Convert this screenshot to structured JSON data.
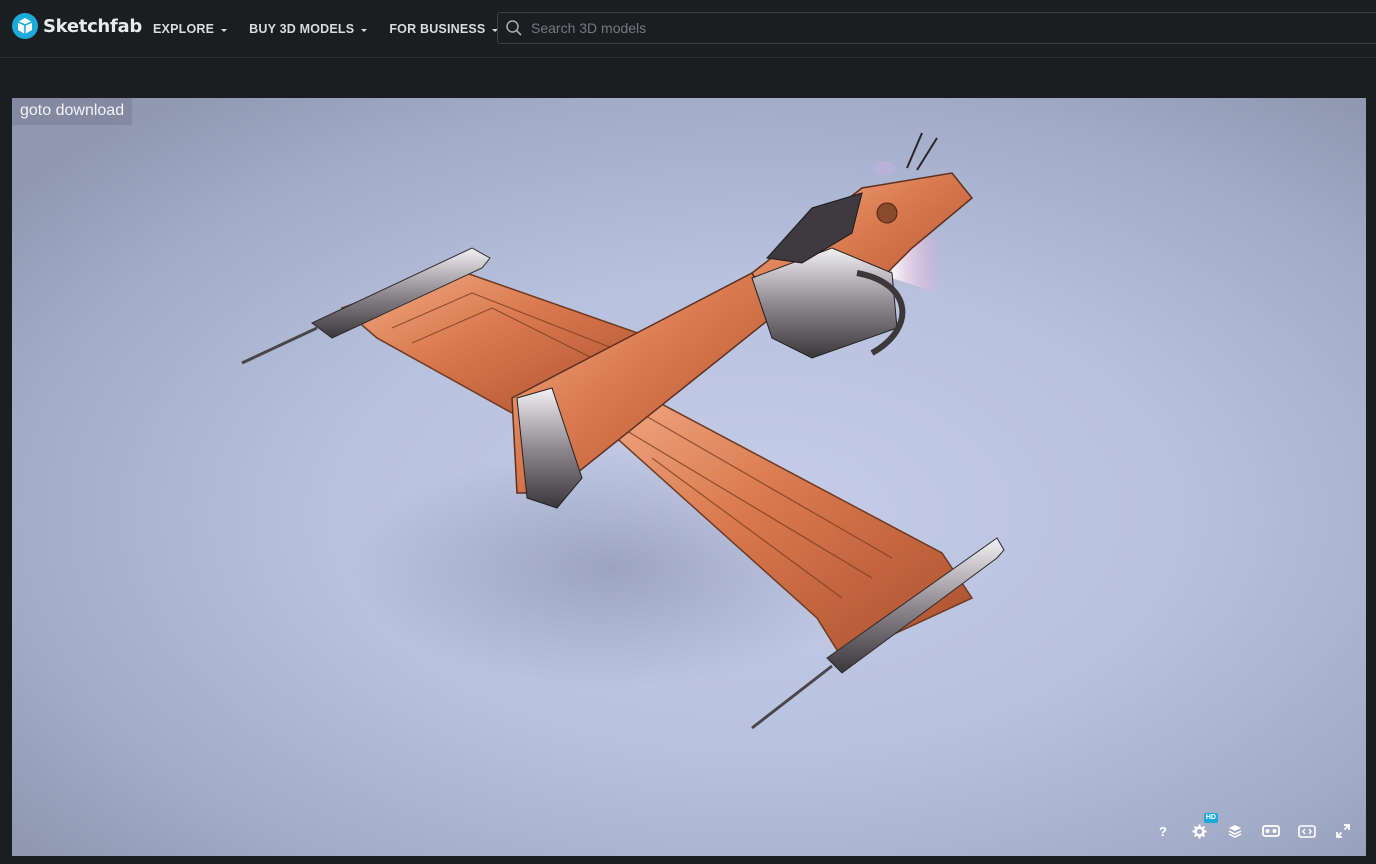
{
  "brand": {
    "name": "Sketchfab",
    "accent": "#1caad9"
  },
  "nav": {
    "items": [
      {
        "label": "EXPLORE"
      },
      {
        "label": "BUY 3D MODELS"
      },
      {
        "label": "FOR BUSINESS"
      }
    ]
  },
  "search": {
    "placeholder": "Search 3D models",
    "value": ""
  },
  "viewer": {
    "goto_label": "goto download",
    "controls": {
      "help_label": "?",
      "hd_badge": "HD",
      "icons": [
        "help-icon",
        "settings-icon",
        "layers-icon",
        "vr-icon",
        "embed-icon",
        "fullscreen-icon"
      ]
    }
  }
}
